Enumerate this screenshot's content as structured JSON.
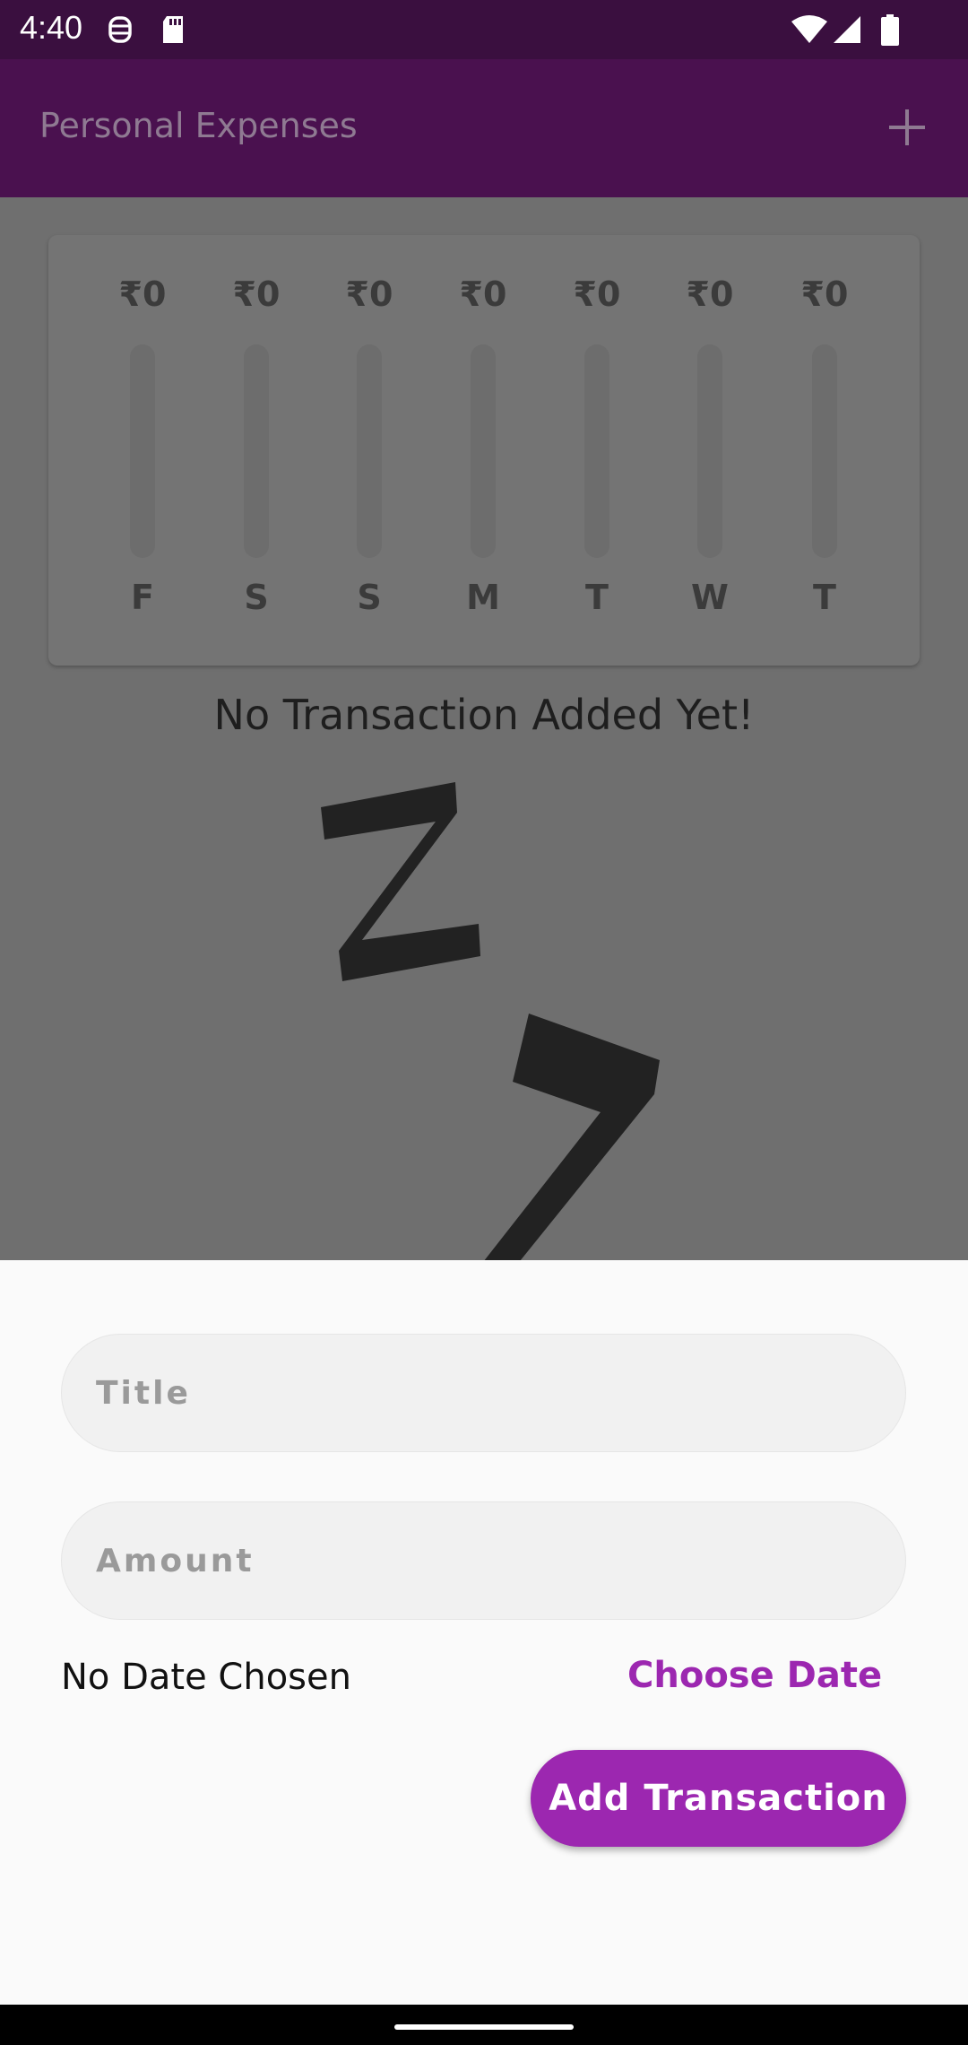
{
  "status_bar": {
    "time": "4:40",
    "icons": [
      "face-icon",
      "sd-card-icon",
      "wifi-icon",
      "signal-icon",
      "battery-icon"
    ]
  },
  "app_bar": {
    "title": "Personal Expenses",
    "action_icon": "add-icon"
  },
  "chart": {
    "bars": [
      {
        "amount": "₹0",
        "day": "F",
        "fraction": 0
      },
      {
        "amount": "₹0",
        "day": "S",
        "fraction": 0
      },
      {
        "amount": "₹0",
        "day": "S",
        "fraction": 0
      },
      {
        "amount": "₹0",
        "day": "M",
        "fraction": 0
      },
      {
        "amount": "₹0",
        "day": "T",
        "fraction": 0
      },
      {
        "amount": "₹0",
        "day": "W",
        "fraction": 0
      },
      {
        "amount": "₹0",
        "day": "T",
        "fraction": 0
      }
    ]
  },
  "empty_state": {
    "message": "No Transaction Added Yet!",
    "image_icon": "zzz-icon"
  },
  "form": {
    "title_placeholder": "Title",
    "title_value": "",
    "amount_placeholder": "Amount",
    "amount_value": "",
    "date_text": "No Date Chosen",
    "choose_date_label": "Choose Date",
    "submit_label": "Add Transaction"
  },
  "colors": {
    "accent": "#9c27b0",
    "app_bar": "#4a114f",
    "status_bar": "#3a0f3f"
  }
}
